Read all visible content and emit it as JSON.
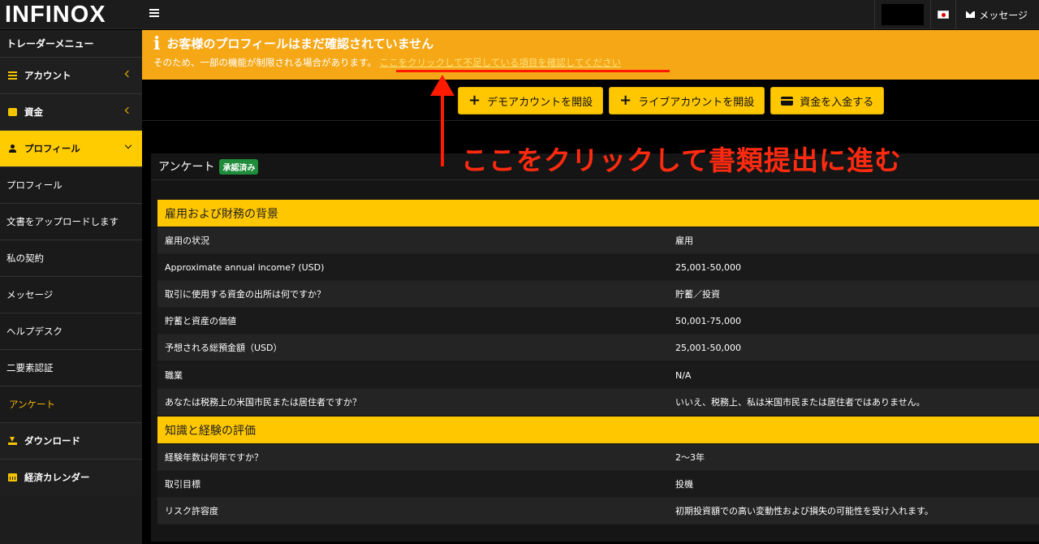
{
  "header": {
    "logo": "INFINOX",
    "messages_label": "メッセージ"
  },
  "sidebar": {
    "title": "トレーダーメニュー",
    "items": [
      {
        "label": "アカウント"
      },
      {
        "label": "資金"
      },
      {
        "label": "プロフィール"
      },
      {
        "label": "プロフィール"
      },
      {
        "label": "文書をアップロードします"
      },
      {
        "label": "私の契約"
      },
      {
        "label": "メッセージ"
      },
      {
        "label": "ヘルプデスク"
      },
      {
        "label": "二要素認証"
      },
      {
        "label": "アンケート"
      },
      {
        "label": "ダウンロード"
      },
      {
        "label": "経済カレンダー"
      }
    ]
  },
  "alert": {
    "title": "お客様のプロフィールはまだ確認されていません",
    "text": "そのため、一部の機能が制限される場合があります。",
    "link": "ここをクリックして不足している項目を確認してください"
  },
  "buttons": {
    "demo": "デモアカウントを開設",
    "live": "ライブアカウントを開設",
    "deposit": "資金を入金する"
  },
  "annotation": "ここをクリックして書類提出に進む",
  "panel": {
    "title": "アンケート",
    "badge": "承認済み",
    "section1": "雇用および財務の背景",
    "section2": "知識と経験の評価",
    "rows": [
      {
        "q": "雇用の状況",
        "a": "雇用"
      },
      {
        "q": "Approximate annual income? (USD)",
        "a": "25,001-50,000"
      },
      {
        "q": "取引に使用する資金の出所は何ですか？",
        "a": "貯蓄／投資"
      },
      {
        "q": "貯蓄と資産の価値",
        "a": "50,001-75,000"
      },
      {
        "q": "予想される総預金額（USD）",
        "a": "25,001-50,000"
      },
      {
        "q": "職業",
        "a": "N/A"
      },
      {
        "q": "あなたは税務上の米国市民または居住者ですか？",
        "a": "いいえ、税務上、私は米国市民または居住者ではありません。"
      },
      {
        "q": "経験年数は何年ですか？",
        "a": "2〜3年"
      },
      {
        "q": "取引目標",
        "a": "投機"
      },
      {
        "q": "リスク許容度",
        "a": "初期投資額での高い変動性および損失の可能性を受け入れます。"
      }
    ]
  },
  "colors": {
    "accent": "#ffc700",
    "alert": "#f5a716",
    "annotation_red": "#ff1a00",
    "badge_green": "#1e8c3a"
  }
}
